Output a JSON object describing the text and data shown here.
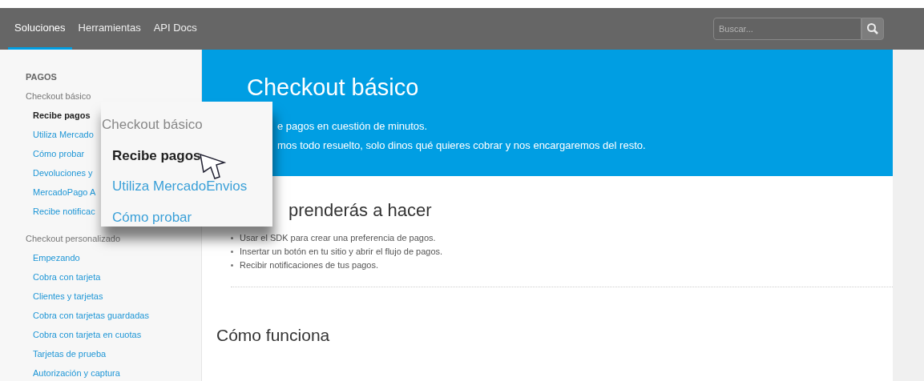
{
  "nav": {
    "tabs": [
      {
        "label": "Soluciones",
        "selected": true
      },
      {
        "label": "Herramientas",
        "selected": false
      },
      {
        "label": "API Docs",
        "selected": false
      }
    ],
    "search": {
      "placeholder": "Buscar..."
    }
  },
  "sidebar": {
    "section": "PAGOS",
    "groups": [
      {
        "title": "Checkout básico",
        "items": [
          {
            "label": "Recibe pagos",
            "selected": true
          },
          {
            "label": "Utiliza Mercado",
            "selected": false
          },
          {
            "label": "Cómo probar",
            "selected": false
          },
          {
            "label": "Devoluciones y",
            "selected": false
          },
          {
            "label": "MercadoPago A",
            "selected": false
          },
          {
            "label": "Recibe notificac",
            "selected": false
          }
        ]
      },
      {
        "title": "Checkout personalizado",
        "items": [
          {
            "label": "Empezando",
            "selected": false
          },
          {
            "label": "Cobra con tarjeta",
            "selected": false
          },
          {
            "label": "Clientes y tarjetas",
            "selected": false
          },
          {
            "label": "Cobra con tarjetas guardadas",
            "selected": false
          },
          {
            "label": "Cobra con tarjeta en cuotas",
            "selected": false
          },
          {
            "label": "Tarjetas de prueba",
            "selected": false
          },
          {
            "label": "Autorización y captura",
            "selected": false
          }
        ]
      }
    ]
  },
  "hero": {
    "title": "Checkout básico",
    "lines": [
      "e pagos en cuestión de minutos.",
      "mos todo resuelto, solo dinos qué quieres cobrar y nos encargaremos del resto."
    ]
  },
  "learn": {
    "heading": "prenderás a hacer",
    "bullets": [
      "Usar el SDK para crear una preferencia de pagos.",
      "Insertar un botón en tu sitio y abrir el flujo de pagos.",
      "Recibir notificaciones de tus pagos."
    ]
  },
  "how": {
    "heading": "Cómo funciona"
  },
  "magnifier": {
    "title": "Checkout básico",
    "items": [
      {
        "label": "Recibe pagos",
        "selected": true
      },
      {
        "label": "Utiliza MercadoEnvios",
        "selected": false
      },
      {
        "label": "Cómo probar",
        "selected": false
      }
    ]
  }
}
